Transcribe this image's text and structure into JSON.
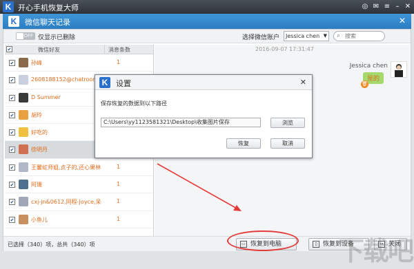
{
  "app": {
    "title": "开心手机恢复大师",
    "logo_letter": "K"
  },
  "window": {
    "title": "微信聊天记录",
    "logo_letter": "K"
  },
  "filter": {
    "toggle_label": "OFF",
    "only_deleted_label": "仅显示已删除",
    "select_account_label": "选择微信账户",
    "account_value": "Jessica chen",
    "search_placeholder": "搜索"
  },
  "list": {
    "col_friend": "微信好友",
    "col_count": "消息条数",
    "rows": [
      {
        "name": "孙峰",
        "count": "1",
        "color": "#8a6a4a"
      },
      {
        "name": "2608188152@chatroom",
        "count": "",
        "color": "#c8d0e0"
      },
      {
        "name": "D        Summer",
        "count": "",
        "color": "#3a3a3a"
      },
      {
        "name": "胡玲",
        "count": "",
        "color": "#e8a040"
      },
      {
        "name": "好吃的",
        "count": "",
        "color": "#f0c040"
      },
      {
        "name": "徐明月",
        "count": "",
        "color": "#d07050",
        "selected": true
      },
      {
        "name": "王馨虹师姐,贞子的,还心果林",
        "count": "1",
        "color": "#b0b8c8"
      },
      {
        "name": "阿珊",
        "count": "1",
        "color": "#507090"
      },
      {
        "name": "cxj-jn&0612,同程-Joyce,呆",
        "count": "1",
        "color": "#a0a8b8"
      },
      {
        "name": "小鱼儿",
        "count": "1",
        "color": "#c89060"
      }
    ]
  },
  "chat": {
    "timestamp": "2016-09-07 17:31:47",
    "sender": "Jessica chen",
    "message": "是的"
  },
  "bottom": {
    "status": "已选择（340）项，总共（340）项",
    "recover_pc": "恢复到电脑",
    "recover_device": "恢复到设备",
    "close": "关闭"
  },
  "dialog": {
    "title": "设置",
    "logo_letter": "K",
    "label": "保存恢复的数据到以下路径",
    "path": "C:\\Users\\yy1123581321\\Desktop\\收集图片保存",
    "browse": "浏览",
    "recover": "恢复",
    "cancel": "取消"
  },
  "watermark": "下载吧",
  "colors": {
    "accent": "#2c7dc2",
    "highlight": "#e43a3a",
    "name_text": "#e06c1c"
  }
}
